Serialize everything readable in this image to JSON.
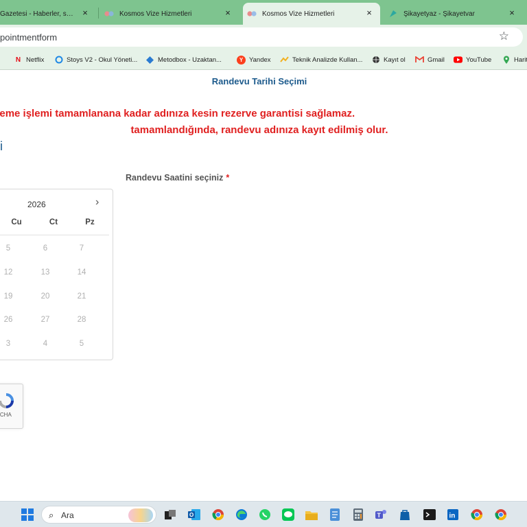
{
  "browser": {
    "tabs": [
      {
        "title": "Gazetesi - Haberler, son dak",
        "icon": "newspaper-icon",
        "active": false
      },
      {
        "title": "Kosmos Vize Hizmetleri",
        "icon": "kosmos-icon",
        "active": false
      },
      {
        "title": "Kosmos Vize Hizmetleri",
        "icon": "kosmos-icon",
        "active": true
      },
      {
        "title": "Şikayetyaz - Şikayetvar",
        "icon": "sikayetyaz-icon",
        "active": false
      }
    ],
    "close_glyph": "×",
    "url": "pointmentform",
    "bookmark_star": "☆"
  },
  "bookmarks": [
    {
      "label": "Netflix",
      "icon": "netflix-icon"
    },
    {
      "label": "Stoys V2 - Okul Yöneti...",
      "icon": "stoys-icon"
    },
    {
      "label": "Metodbox - Uzaktan...",
      "icon": "metodbox-icon"
    },
    {
      "label": "Yandex",
      "icon": "yandex-icon"
    },
    {
      "label": "Teknik Analizde Kullan...",
      "icon": "analysis-icon"
    },
    {
      "label": "Kayıt ol",
      "icon": "globe-icon"
    },
    {
      "label": "Gmail",
      "icon": "gmail-icon"
    },
    {
      "label": "YouTube",
      "icon": "youtube-icon"
    },
    {
      "label": "Harit",
      "icon": "maps-icon"
    }
  ],
  "page": {
    "section_title": "Randevu Tarihi Seçimi",
    "warning_line1": "tarihi, son adımdaki ödeme işlemi tamamlanana kadar adınıza kesin rezerve garantisi sağlamaz.",
    "warning_line2": "tamamlandığında, randevu adınıza kayıt edilmiş olur.",
    "left_heading": "i",
    "time_label": "Randevu Saatini seçiniz",
    "required_mark": "*",
    "colors": {
      "heading": "#1c5a8c",
      "warning": "#e02020"
    }
  },
  "calendar": {
    "year": "2026",
    "next_glyph": "›",
    "weekdays": [
      "Cu",
      "Ct",
      "Pz"
    ],
    "weeks": [
      [
        "5",
        "6",
        "7"
      ],
      [
        "12",
        "13",
        "14"
      ],
      [
        "19",
        "20",
        "21"
      ],
      [
        "26",
        "27",
        "28"
      ],
      [
        "3",
        "4",
        "5"
      ]
    ]
  },
  "recaptcha": {
    "label": "TCHA"
  },
  "taskbar": {
    "search_text": "Ara",
    "search_glyph": "⌕",
    "apps": [
      "windows-start-icon",
      "task-view-icon",
      "outlook-icon",
      "chrome-profile-icon",
      "edge-icon",
      "whatsapp-icon",
      "line-icon",
      "file-explorer-icon",
      "notepad-icon",
      "calculator-icon",
      "teams-icon",
      "store-icon",
      "terminal-icon",
      "linkedin-icon",
      "chrome-profile2-icon",
      "chrome-icon"
    ]
  }
}
